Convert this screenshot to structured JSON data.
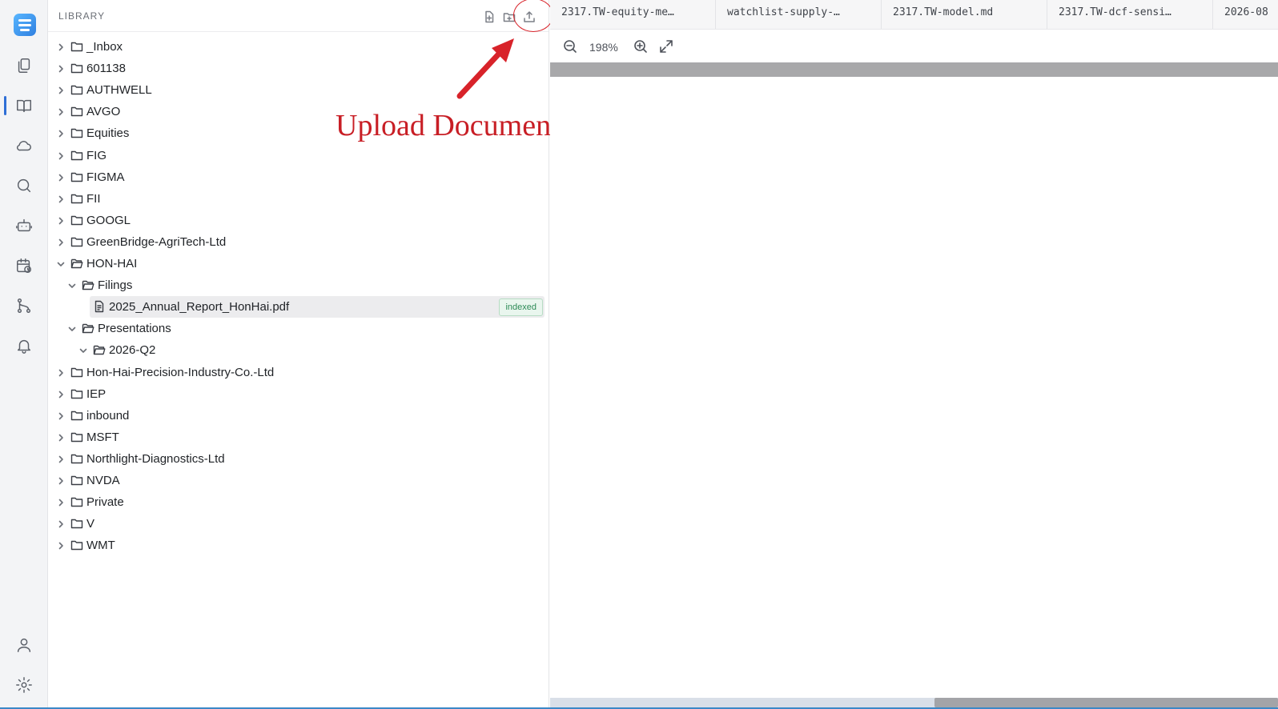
{
  "rail": {
    "items": [
      {
        "name": "documents",
        "icon": "documents-icon",
        "active": false
      },
      {
        "name": "library",
        "icon": "book-open-icon",
        "active": true
      },
      {
        "name": "cloud",
        "icon": "cloud-icon",
        "active": false
      },
      {
        "name": "search",
        "icon": "search-icon",
        "active": false
      },
      {
        "name": "agent",
        "icon": "robot-icon",
        "active": false
      },
      {
        "name": "schedule",
        "icon": "calendar-clock-icon",
        "active": false
      },
      {
        "name": "workflows",
        "icon": "git-branch-icon",
        "active": false
      },
      {
        "name": "notifications",
        "icon": "bell-icon",
        "active": false
      }
    ],
    "bottom": [
      {
        "name": "profile",
        "icon": "user-icon"
      },
      {
        "name": "settings",
        "icon": "gear-icon"
      }
    ]
  },
  "library": {
    "title": "LIBRARY",
    "actions": [
      "new-file-icon",
      "new-folder-icon",
      "upload-icon"
    ],
    "tree": [
      {
        "label": "_Inbox",
        "depth": 0,
        "type": "folder",
        "expanded": false
      },
      {
        "label": "601138",
        "depth": 0,
        "type": "folder",
        "expanded": false
      },
      {
        "label": "AUTHWELL",
        "depth": 0,
        "type": "folder",
        "expanded": false
      },
      {
        "label": "AVGO",
        "depth": 0,
        "type": "folder",
        "expanded": false
      },
      {
        "label": "Equities",
        "depth": 0,
        "type": "folder",
        "expanded": false
      },
      {
        "label": "FIG",
        "depth": 0,
        "type": "folder",
        "expanded": false
      },
      {
        "label": "FIGMA",
        "depth": 0,
        "type": "folder",
        "expanded": false
      },
      {
        "label": "FII",
        "depth": 0,
        "type": "folder",
        "expanded": false
      },
      {
        "label": "GOOGL",
        "depth": 0,
        "type": "folder",
        "expanded": false
      },
      {
        "label": "GreenBridge-AgriTech-Ltd",
        "depth": 0,
        "type": "folder",
        "expanded": false
      },
      {
        "label": "HON-HAI",
        "depth": 0,
        "type": "folder",
        "expanded": true
      },
      {
        "label": "Filings",
        "depth": 1,
        "type": "folder",
        "expanded": true
      },
      {
        "label": "2025_Annual_Report_HonHai.pdf",
        "depth": 2,
        "type": "file",
        "selected": true,
        "badge": "indexed"
      },
      {
        "label": "Presentations",
        "depth": 1,
        "type": "folder",
        "expanded": true
      },
      {
        "label": "2026-Q2",
        "depth": 2,
        "type": "folder",
        "expanded": true
      },
      {
        "label": "Hon-Hai-Precision-Industry-Co.-Ltd",
        "depth": 0,
        "type": "folder",
        "expanded": false
      },
      {
        "label": "IEP",
        "depth": 0,
        "type": "folder",
        "expanded": false
      },
      {
        "label": "inbound",
        "depth": 0,
        "type": "folder",
        "expanded": false
      },
      {
        "label": "MSFT",
        "depth": 0,
        "type": "folder",
        "expanded": false
      },
      {
        "label": "Northlight-Diagnostics-Ltd",
        "depth": 0,
        "type": "folder",
        "expanded": false
      },
      {
        "label": "NVDA",
        "depth": 0,
        "type": "folder",
        "expanded": false
      },
      {
        "label": "Private",
        "depth": 0,
        "type": "folder",
        "expanded": false
      },
      {
        "label": "V",
        "depth": 0,
        "type": "folder",
        "expanded": false
      },
      {
        "label": "WMT",
        "depth": 0,
        "type": "folder",
        "expanded": false
      }
    ]
  },
  "annotation": {
    "text": "Upload Documents",
    "color": "#c81e25"
  },
  "viewer": {
    "tabs": [
      "2317.TW-equity-me…",
      "watchlist-supply-…",
      "2317.TW-model.md",
      "2317.TW-dcf-sensi…",
      "2026-08"
    ],
    "zoom": "198%",
    "tools": [
      "zoom-out-icon",
      "zoom-in-icon",
      "expand-icon"
    ]
  },
  "colors": {
    "accent": "#2f6fd6",
    "indexed_badge": "#2e8b57"
  }
}
